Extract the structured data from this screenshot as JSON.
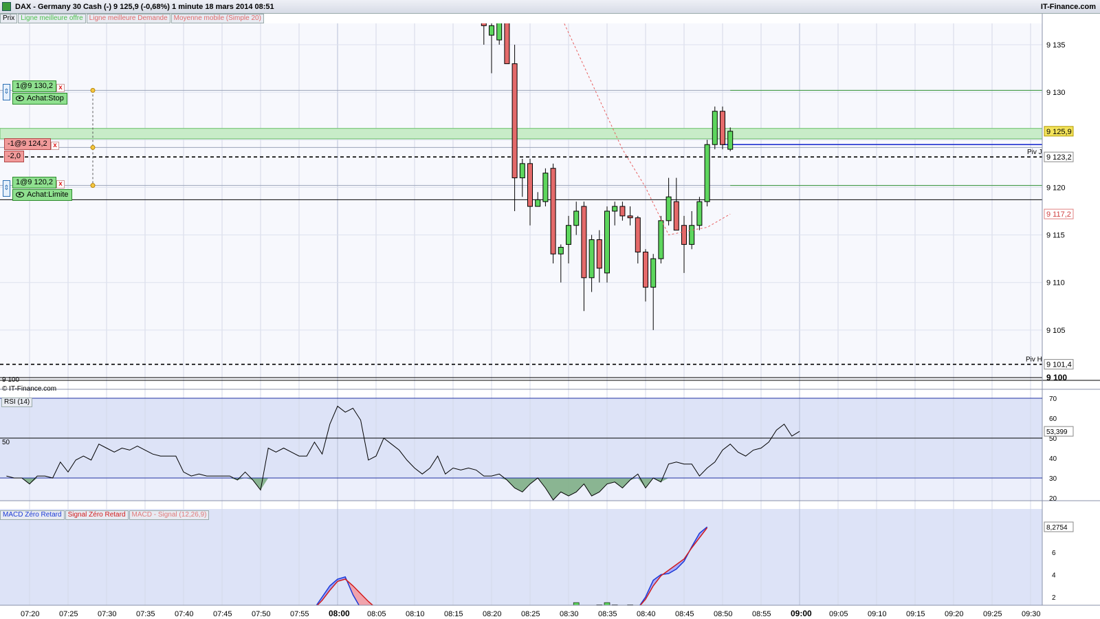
{
  "header": {
    "title": "DAX - Germany 30 Cash (-)    9 125,9 (-0,68%)    1 minute  18 mars 2014 08:51",
    "brand": "IT-Finance.com"
  },
  "legend": {
    "prix": "Prix",
    "best_offer": "Ligne meilleure offre",
    "best_demand": "Ligne meilleure Demande",
    "ma": "Moyenne mobile (Simple 20)"
  },
  "colors": {
    "up": "#5dd65d",
    "down": "#e46a6a",
    "ma": "#e86060",
    "bid_line": "#2030d0",
    "panel_bg": "#dde3f7",
    "green_zone": "#c8ecc8"
  },
  "orders": {
    "stop": {
      "qty": "1@9 130,2",
      "label": "Achat:Stop"
    },
    "sell": {
      "qty": "-1@9 124,2",
      "pnl": "-2,0"
    },
    "limit": {
      "qty": "1@9 120,2",
      "label": "Achat:Limite"
    },
    "close_icon": "x"
  },
  "price_axis": {
    "ticks": [
      "9 135",
      "9 130",
      "9 120",
      "9 115",
      "9 110",
      "9 105",
      "9 100"
    ],
    "last": "9 125,9",
    "pivot_j_value": "9 123,2",
    "pivot_h_value": "9 101,4",
    "ma_value": "9 117,2",
    "pivot_j": "Piv J",
    "pivot_h": "Piv H",
    "left_9100": "9 100",
    "copyright": "© IT-Finance.com"
  },
  "rsi": {
    "label": "RSI (14)",
    "ticks": [
      "70",
      "60",
      "50",
      "40",
      "30",
      "20"
    ],
    "mid_label": "50",
    "last": "53,399"
  },
  "macd": {
    "label_macd": "MACD Zéro Retard",
    "label_signal": "Signal Zéro Retard",
    "label_hist": "MACD - Signal (12,26,9)",
    "ticks": [
      "6",
      "4",
      "2"
    ],
    "last": "8,2754"
  },
  "time_axis": {
    "ticks": [
      "07:20",
      "07:25",
      "07:30",
      "07:35",
      "07:40",
      "07:45",
      "07:50",
      "07:55",
      "08:00",
      "08:05",
      "08:10",
      "08:15",
      "08:20",
      "08:25",
      "08:30",
      "08:35",
      "08:40",
      "08:45",
      "08:50",
      "08:55",
      "09:00",
      "09:05",
      "09:10",
      "09:15",
      "09:20",
      "09:25",
      "09:30"
    ],
    "bold": [
      "08:00",
      "09:00"
    ]
  },
  "chart_data": {
    "type": "candlestick",
    "ylim": [
      9099,
      9138
    ],
    "levels": {
      "stop": 9130.2,
      "sell": 9124.2,
      "limit": 9120.2,
      "pivot_j": 9123.2,
      "pivot_h": 9101.4,
      "bid": 9124.5,
      "black_line": 9118.7,
      "green_zone": [
        9125.1,
        9126.2
      ]
    },
    "candles": [
      {
        "t": "08:19",
        "o": 9138,
        "h": 9139,
        "l": 9135,
        "c": 9137
      },
      {
        "t": "08:20",
        "o": 9136,
        "h": 9139,
        "l": 9132,
        "c": 9137
      },
      {
        "t": "08:21",
        "o": 9135.5,
        "h": 9139,
        "l": 9135,
        "c": 9138
      },
      {
        "t": "08:22",
        "o": 9139,
        "h": 9140,
        "l": 9133,
        "c": 9133
      },
      {
        "t": "08:23",
        "o": 9133,
        "h": 9135,
        "l": 9117.5,
        "c": 9121
      },
      {
        "t": "08:24",
        "o": 9121,
        "h": 9123,
        "l": 9119,
        "c": 9122.5
      },
      {
        "t": "08:25",
        "o": 9122.5,
        "h": 9123,
        "l": 9116,
        "c": 9118
      },
      {
        "t": "08:26",
        "o": 9118,
        "h": 9119.5,
        "l": 9118,
        "c": 9118.7
      },
      {
        "t": "08:27",
        "o": 9118.5,
        "h": 9122,
        "l": 9118,
        "c": 9121.5
      },
      {
        "t": "08:28",
        "o": 9122,
        "h": 9122.5,
        "l": 9112,
        "c": 9113
      },
      {
        "t": "08:29",
        "o": 9113,
        "h": 9114,
        "l": 9110,
        "c": 9113.7
      },
      {
        "t": "08:30",
        "o": 9114,
        "h": 9117,
        "l": 9112,
        "c": 9116
      },
      {
        "t": "08:31",
        "o": 9116,
        "h": 9118.5,
        "l": 9115,
        "c": 9117.5
      },
      {
        "t": "08:32",
        "o": 9118,
        "h": 9118.5,
        "l": 9107,
        "c": 9110.5
      },
      {
        "t": "08:33",
        "o": 9110.5,
        "h": 9115,
        "l": 9109,
        "c": 9114.5
      },
      {
        "t": "08:34",
        "o": 9114.5,
        "h": 9115.5,
        "l": 9110,
        "c": 9111.5
      },
      {
        "t": "08:35",
        "o": 9111,
        "h": 9118,
        "l": 9110,
        "c": 9117.5
      },
      {
        "t": "08:36",
        "o": 9117.5,
        "h": 9118.5,
        "l": 9116,
        "c": 9118
      },
      {
        "t": "08:37",
        "o": 9118,
        "h": 9118.5,
        "l": 9116.5,
        "c": 9117
      },
      {
        "t": "08:38",
        "o": 9117,
        "h": 9118,
        "l": 9116,
        "c": 9116.8
      },
      {
        "t": "08:39",
        "o": 9116.8,
        "h": 9117,
        "l": 9112,
        "c": 9113.2
      },
      {
        "t": "08:40",
        "o": 9113.2,
        "h": 9113.5,
        "l": 9108,
        "c": 9109.5
      },
      {
        "t": "08:41",
        "o": 9109.5,
        "h": 9113,
        "l": 9105,
        "c": 9112.5
      },
      {
        "t": "08:42",
        "o": 9112.5,
        "h": 9117,
        "l": 9112,
        "c": 9116.5
      },
      {
        "t": "08:43",
        "o": 9116.5,
        "h": 9121,
        "l": 9116,
        "c": 9119
      },
      {
        "t": "08:44",
        "o": 9118.5,
        "h": 9121,
        "l": 9115.5,
        "c": 9115.5
      },
      {
        "t": "08:45",
        "o": 9116,
        "h": 9117,
        "l": 9111,
        "c": 9114
      },
      {
        "t": "08:46",
        "o": 9114,
        "h": 9117.5,
        "l": 9113.5,
        "c": 9116
      },
      {
        "t": "08:47",
        "o": 9116,
        "h": 9119,
        "l": 9115.5,
        "c": 9118.5
      },
      {
        "t": "08:48",
        "o": 9118.5,
        "h": 9125,
        "l": 9118,
        "c": 9124.5
      },
      {
        "t": "08:49",
        "o": 9124.5,
        "h": 9128.5,
        "l": 9124,
        "c": 9128
      },
      {
        "t": "08:50",
        "o": 9128,
        "h": 9128.5,
        "l": 9124,
        "c": 9124.5
      },
      {
        "t": "08:51",
        "o": 9124,
        "h": 9126.3,
        "l": 9123.8,
        "c": 9125.9
      }
    ],
    "ma": [
      {
        "t": "08:29",
        "v": 9138
      },
      {
        "t": "08:33",
        "v": 9131
      },
      {
        "t": "08:37",
        "v": 9124
      },
      {
        "t": "08:40",
        "v": 9120
      },
      {
        "t": "08:43",
        "v": 9115
      },
      {
        "t": "08:46",
        "v": 9115.5
      },
      {
        "t": "08:48",
        "v": 9115.8
      },
      {
        "t": "08:51",
        "v": 9117.2
      }
    ],
    "rsi": {
      "ylim": [
        17,
        72
      ],
      "values": [
        {
          "t": "07:17",
          "v": 31
        },
        {
          "t": "07:18",
          "v": 30
        },
        {
          "t": "07:19",
          "v": 30
        },
        {
          "t": "07:20",
          "v": 27
        },
        {
          "t": "07:21",
          "v": 31
        },
        {
          "t": "07:22",
          "v": 31
        },
        {
          "t": "07:23",
          "v": 30
        },
        {
          "t": "07:24",
          "v": 38
        },
        {
          "t": "07:25",
          "v": 33
        },
        {
          "t": "07:26",
          "v": 39
        },
        {
          "t": "07:27",
          "v": 41
        },
        {
          "t": "07:28",
          "v": 39
        },
        {
          "t": "07:29",
          "v": 47
        },
        {
          "t": "07:30",
          "v": 45
        },
        {
          "t": "07:31",
          "v": 43
        },
        {
          "t": "07:32",
          "v": 45
        },
        {
          "t": "07:33",
          "v": 44
        },
        {
          "t": "07:34",
          "v": 46
        },
        {
          "t": "07:35",
          "v": 44
        },
        {
          "t": "07:36",
          "v": 42
        },
        {
          "t": "07:37",
          "v": 41
        },
        {
          "t": "07:38",
          "v": 41
        },
        {
          "t": "07:39",
          "v": 41
        },
        {
          "t": "07:40",
          "v": 33
        },
        {
          "t": "07:41",
          "v": 31
        },
        {
          "t": "07:42",
          "v": 32
        },
        {
          "t": "07:43",
          "v": 31
        },
        {
          "t": "07:44",
          "v": 31
        },
        {
          "t": "07:45",
          "v": 31
        },
        {
          "t": "07:46",
          "v": 31
        },
        {
          "t": "07:47",
          "v": 29
        },
        {
          "t": "07:48",
          "v": 33
        },
        {
          "t": "07:49",
          "v": 29
        },
        {
          "t": "07:50",
          "v": 24
        },
        {
          "t": "07:51",
          "v": 45
        },
        {
          "t": "07:52",
          "v": 43
        },
        {
          "t": "07:53",
          "v": 45
        },
        {
          "t": "07:54",
          "v": 43
        },
        {
          "t": "07:55",
          "v": 41
        },
        {
          "t": "07:56",
          "v": 41
        },
        {
          "t": "07:57",
          "v": 48
        },
        {
          "t": "07:58",
          "v": 42
        },
        {
          "t": "07:59",
          "v": 57
        },
        {
          "t": "08:00",
          "v": 66
        },
        {
          "t": "08:01",
          "v": 63
        },
        {
          "t": "08:02",
          "v": 65
        },
        {
          "t": "08:03",
          "v": 59
        },
        {
          "t": "08:04",
          "v": 39
        },
        {
          "t": "08:05",
          "v": 41
        },
        {
          "t": "08:06",
          "v": 50
        },
        {
          "t": "08:07",
          "v": 47
        },
        {
          "t": "08:08",
          "v": 44
        },
        {
          "t": "08:09",
          "v": 39
        },
        {
          "t": "08:10",
          "v": 35
        },
        {
          "t": "08:11",
          "v": 32
        },
        {
          "t": "08:12",
          "v": 35
        },
        {
          "t": "08:13",
          "v": 41
        },
        {
          "t": "08:14",
          "v": 32
        },
        {
          "t": "08:15",
          "v": 35
        },
        {
          "t": "08:16",
          "v": 34
        },
        {
          "t": "08:17",
          "v": 35
        },
        {
          "t": "08:18",
          "v": 34
        },
        {
          "t": "08:19",
          "v": 31
        },
        {
          "t": "08:20",
          "v": 31
        },
        {
          "t": "08:21",
          "v": 32
        },
        {
          "t": "08:22",
          "v": 29
        },
        {
          "t": "08:23",
          "v": 25
        },
        {
          "t": "08:24",
          "v": 23
        },
        {
          "t": "08:25",
          "v": 27
        },
        {
          "t": "08:26",
          "v": 30
        },
        {
          "t": "08:27",
          "v": 25
        },
        {
          "t": "08:28",
          "v": 19
        },
        {
          "t": "08:29",
          "v": 23
        },
        {
          "t": "08:30",
          "v": 21
        },
        {
          "t": "08:31",
          "v": 23
        },
        {
          "t": "08:32",
          "v": 27
        },
        {
          "t": "08:33",
          "v": 21
        },
        {
          "t": "08:34",
          "v": 23
        },
        {
          "t": "08:35",
          "v": 27
        },
        {
          "t": "08:36",
          "v": 28
        },
        {
          "t": "08:37",
          "v": 25
        },
        {
          "t": "08:38",
          "v": 29
        },
        {
          "t": "08:39",
          "v": 32
        },
        {
          "t": "08:40",
          "v": 25
        },
        {
          "t": "08:41",
          "v": 30
        },
        {
          "t": "08:42",
          "v": 28
        },
        {
          "t": "08:43",
          "v": 37
        },
        {
          "t": "08:44",
          "v": 38
        },
        {
          "t": "08:45",
          "v": 37
        },
        {
          "t": "08:46",
          "v": 37
        },
        {
          "t": "08:47",
          "v": 31
        },
        {
          "t": "08:48",
          "v": 35
        },
        {
          "t": "08:49",
          "v": 38
        },
        {
          "t": "08:50",
          "v": 44
        },
        {
          "t": "08:51",
          "v": 47
        },
        {
          "t": "08:52",
          "v": 43
        },
        {
          "t": "08:53",
          "v": 41
        },
        {
          "t": "08:54",
          "v": 44
        },
        {
          "t": "08:55",
          "v": 45
        },
        {
          "t": "08:56",
          "v": 48
        },
        {
          "t": "08:57",
          "v": 54
        },
        {
          "t": "08:58",
          "v": 57
        },
        {
          "t": "08:59",
          "v": 51
        },
        {
          "t": "09:00",
          "v": 53.4
        }
      ]
    },
    "macd": {
      "ylim": [
        1,
        9
      ],
      "macd_line": [
        {
          "t": "07:57",
          "v": 1
        },
        {
          "t": "07:58",
          "v": 2
        },
        {
          "t": "07:59",
          "v": 3
        },
        {
          "t": "08:00",
          "v": 3.6
        },
        {
          "t": "08:01",
          "v": 3.8
        },
        {
          "t": "08:02",
          "v": 2.2
        },
        {
          "t": "08:03",
          "v": 1
        }
      ],
      "signal_line": [
        {
          "t": "07:57",
          "v": 1
        },
        {
          "t": "07:58",
          "v": 1.7
        },
        {
          "t": "07:59",
          "v": 2.6
        },
        {
          "t": "08:00",
          "v": 3.4
        },
        {
          "t": "08:01",
          "v": 3.6
        },
        {
          "t": "08:02",
          "v": 3.0
        },
        {
          "t": "08:03",
          "v": 2.3
        },
        {
          "t": "08:04",
          "v": 1.6
        },
        {
          "t": "08:05",
          "v": 1
        }
      ],
      "macd_late": [
        {
          "t": "08:39",
          "v": 1
        },
        {
          "t": "08:40",
          "v": 2
        },
        {
          "t": "08:41",
          "v": 3.5
        },
        {
          "t": "08:42",
          "v": 4
        },
        {
          "t": "08:43",
          "v": 4.1
        },
        {
          "t": "08:44",
          "v": 4.5
        },
        {
          "t": "08:45",
          "v": 5.2
        },
        {
          "t": "08:46",
          "v": 6.5
        },
        {
          "t": "08:47",
          "v": 7.7
        },
        {
          "t": "08:48",
          "v": 8.2754
        }
      ],
      "signal_late": [
        {
          "t": "08:39",
          "v": 1
        },
        {
          "t": "08:40",
          "v": 1.8
        },
        {
          "t": "08:41",
          "v": 3.0
        },
        {
          "t": "08:42",
          "v": 3.9
        },
        {
          "t": "08:43",
          "v": 4.4
        },
        {
          "t": "08:44",
          "v": 4.9
        },
        {
          "t": "08:45",
          "v": 5.4
        },
        {
          "t": "08:46",
          "v": 6.4
        },
        {
          "t": "08:47",
          "v": 7.3
        },
        {
          "t": "08:48",
          "v": 8.2
        }
      ],
      "hist": [
        {
          "t": "08:31",
          "v": 1.5
        },
        {
          "t": "08:34",
          "v": 1.3
        },
        {
          "t": "08:35",
          "v": 1.5
        },
        {
          "t": "08:36",
          "v": 1.3
        },
        {
          "t": "08:37",
          "v": 1.1
        },
        {
          "t": "08:38",
          "v": 1.3
        }
      ]
    }
  }
}
